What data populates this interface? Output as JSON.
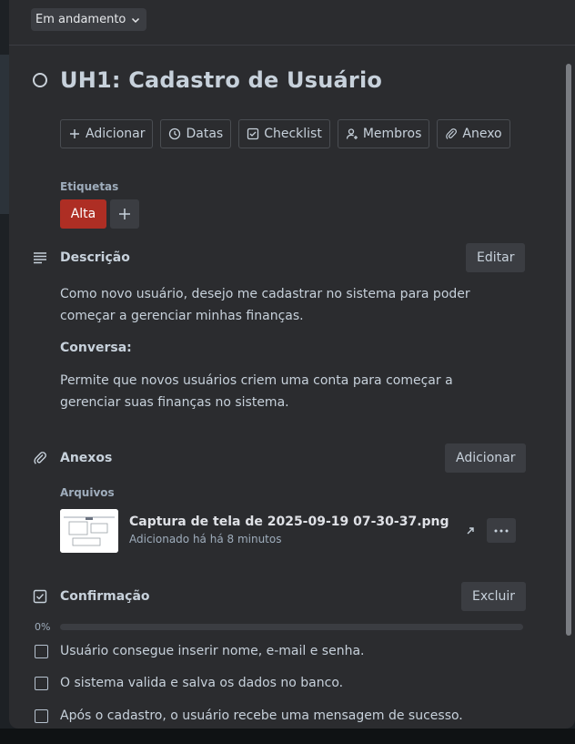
{
  "status": {
    "label": "Em andamento"
  },
  "card": {
    "title": "UH1: Cadastro de Usuário"
  },
  "actions": [
    {
      "label": "Adicionar",
      "icon": "plus-icon"
    },
    {
      "label": "Datas",
      "icon": "clock-icon"
    },
    {
      "label": "Checklist",
      "icon": "checklist-icon"
    },
    {
      "label": "Membros",
      "icon": "add-member-icon"
    },
    {
      "label": "Anexo",
      "icon": "paperclip-icon"
    }
  ],
  "labels": {
    "heading": "Etiquetas",
    "items": [
      {
        "text": "Alta",
        "color": "#ae2e24"
      }
    ]
  },
  "description": {
    "heading": "Descrição",
    "edit_label": "Editar",
    "paragraph1": "Como novo usuário, desejo me cadastrar no sistema para poder começar a gerenciar minhas finanças.",
    "conversation_heading": "Conversa:",
    "paragraph2": "Permite que novos usuários criem uma conta para começar a gerenciar suas finanças no sistema."
  },
  "attachments": {
    "heading": "Anexos",
    "add_label": "Adicionar",
    "files_heading": "Arquivos",
    "files": [
      {
        "name": "Captura de tela de 2025-09-19 07-30-37.png",
        "meta": "Adicionado há há 8 minutos"
      }
    ]
  },
  "checklist": {
    "heading": "Confirmação",
    "delete_label": "Excluir",
    "progress_label": "0%",
    "progress": 0,
    "items": [
      {
        "text": "Usuário consegue inserir nome, e-mail e senha.",
        "checked": false
      },
      {
        "text": "O sistema valida e salva os dados no banco.",
        "checked": false
      },
      {
        "text": "Após o cadastro, o usuário recebe uma mensagem de sucesso.",
        "checked": false
      }
    ]
  }
}
